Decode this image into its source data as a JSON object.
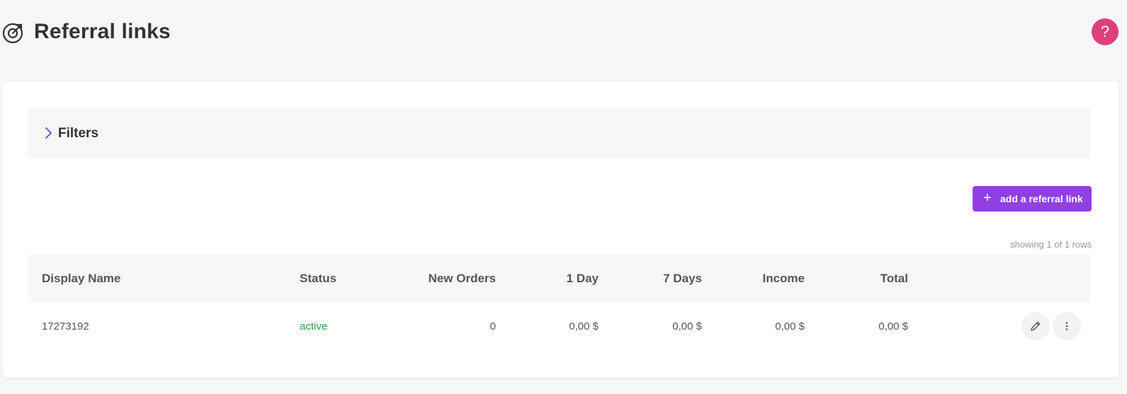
{
  "header": {
    "title": "Referral links",
    "title_icon": "target-icon",
    "help_label": "?"
  },
  "filters": {
    "label": "Filters",
    "icon": "chevron-right-icon"
  },
  "toolbar": {
    "add_label": "add a referral link",
    "add_icon": "plus-icon"
  },
  "table": {
    "row_count_text": "showing 1 of 1 rows",
    "columns": [
      "Display Name",
      "Status",
      "New Orders",
      "1 Day",
      "7 Days",
      "Income",
      "Total"
    ],
    "rows": [
      {
        "display_name": "17273192",
        "status": "active",
        "new_orders": "0",
        "one_day": "0,00 $",
        "seven_days": "0,00 $",
        "income": "0,00 $",
        "total": "0,00 $"
      }
    ]
  },
  "colors": {
    "accent": "#9040e0",
    "help": "#e0407a",
    "status_active": "#3a9a4a"
  }
}
